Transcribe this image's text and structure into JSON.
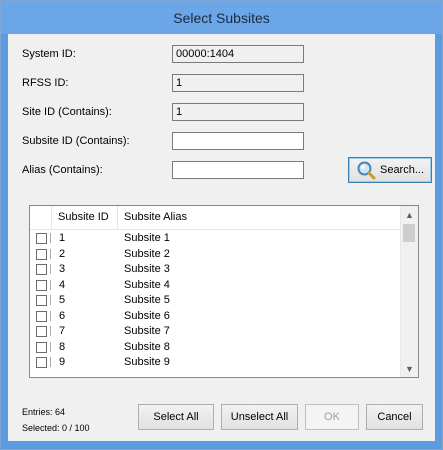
{
  "window": {
    "title": "Select Subsites"
  },
  "form": {
    "system_id": {
      "label": "System ID:",
      "value": "00000:1404"
    },
    "rfss_id": {
      "label": "RFSS ID:",
      "value": "1"
    },
    "site_id": {
      "label": "Site ID (Contains):",
      "value": "1"
    },
    "subsite_id": {
      "label": "Subsite ID (Contains):",
      "value": ""
    },
    "alias": {
      "label": "Alias (Contains):",
      "value": ""
    },
    "search_label": "Search...",
    "search_icon": "magnifier-icon"
  },
  "list": {
    "columns": [
      "",
      "Subsite ID",
      "Subsite Alias"
    ],
    "rows": [
      {
        "id": "1",
        "alias": "Subsite 1"
      },
      {
        "id": "2",
        "alias": "Subsite 2"
      },
      {
        "id": "3",
        "alias": "Subsite 3"
      },
      {
        "id": "4",
        "alias": "Subsite 4"
      },
      {
        "id": "5",
        "alias": "Subsite 5"
      },
      {
        "id": "6",
        "alias": "Subsite 6"
      },
      {
        "id": "7",
        "alias": "Subsite 7"
      },
      {
        "id": "8",
        "alias": "Subsite 8"
      },
      {
        "id": "9",
        "alias": "Subsite 9"
      }
    ]
  },
  "status": {
    "entries": "Entries: 64",
    "selected": "Selected: 0 / 100"
  },
  "buttons": {
    "select_all": "Select All",
    "unselect_all": "Unselect All",
    "ok": "OK",
    "cancel": "Cancel"
  },
  "colors": {
    "title_bar": "#6aa6e8",
    "window_border": "#5b9be0",
    "client_bg": "#f0f0f0"
  }
}
